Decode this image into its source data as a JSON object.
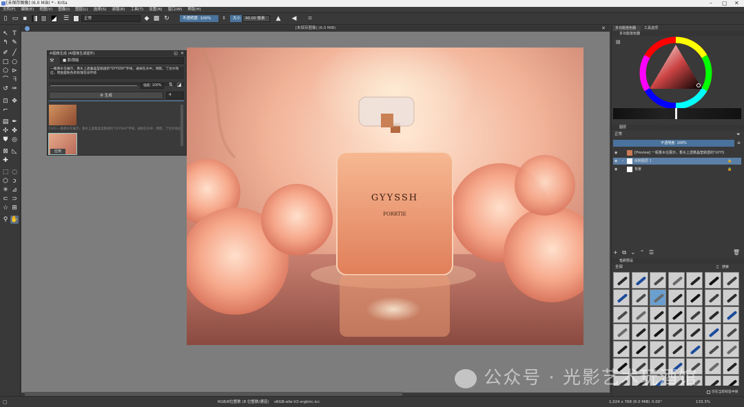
{
  "window": {
    "title": "[未保存图像] (6.0 MiB) * - Krita"
  },
  "menu": [
    "文件(F)",
    "编辑(E)",
    "视图(V)",
    "图像(I)",
    "图层(L)",
    "选择(S)",
    "滤镜(R)",
    "工具(T)",
    "设置(N)",
    "窗口(W)",
    "帮助(H)"
  ],
  "toolbar": {
    "blend_mode": "正常",
    "opacity_label": "不透明度: 100%",
    "size_label": "大小",
    "size_value": "40.00 像素"
  },
  "document": {
    "tab_title": "[未保存图像] (6.0 MiB)"
  },
  "ai_dock": {
    "title": "AI图像生成 (AI图像生成插件)",
    "style": "■ 影视级",
    "prompt": "一瓶香水在展示，香水上透着晶莹剔透的\"GYYSSH\"字样。通体在水中，倒影，丁达尔效应，周围是粉色的玫瑰花朵环绕",
    "strength_label": "强度: 100%",
    "generate_label": "生成",
    "batch_count": "4",
    "history_caption": "[1/4] 一瓶香水在展示，香水上透着晶莹剔透的\"GYYSSH\"字样，通体在水中，倒影，丁达尔效应，周围",
    "apply_label": "应用"
  },
  "artwork": {
    "brand": "GYYSSH",
    "sub": "PORRTIE"
  },
  "right_dock": {
    "tab_color": "多功能拾色器",
    "tab_tools": "工具选项",
    "color_panel_title": "多功能拾色器",
    "layers_title": "图层",
    "layers_blend": "正常",
    "layers_opacity": "不透明度: 100%",
    "layers": [
      {
        "name": "[Preview] 一瓶香水在展示，香水上透着晶莹剔透的\"GYYS",
        "selected": false
      },
      {
        "name": "绘制图层 1",
        "selected": true
      },
      {
        "name": "背景",
        "selected": false
      }
    ],
    "brush_panel_title": "笔刷预设",
    "brush_tag": "全部",
    "brush_search": "搜索",
    "brush_filter_label": "仅在当前标签中搜索"
  },
  "status": {
    "color_space": "RGB/8位整数 (8 位整数/通道)",
    "profile": "sRGB-elle-V2-srgbtrc.icc",
    "dimensions": "1,024 x 768 (6.0 MiB)",
    "rotation": "0.00°",
    "zoom": "133.3%"
  },
  "watermark": "公众号 · 光影艺术玩酒馆",
  "colors": {
    "accent": "#49739c",
    "canvas_bg": "#7d7d7d",
    "panel": "#393939"
  }
}
